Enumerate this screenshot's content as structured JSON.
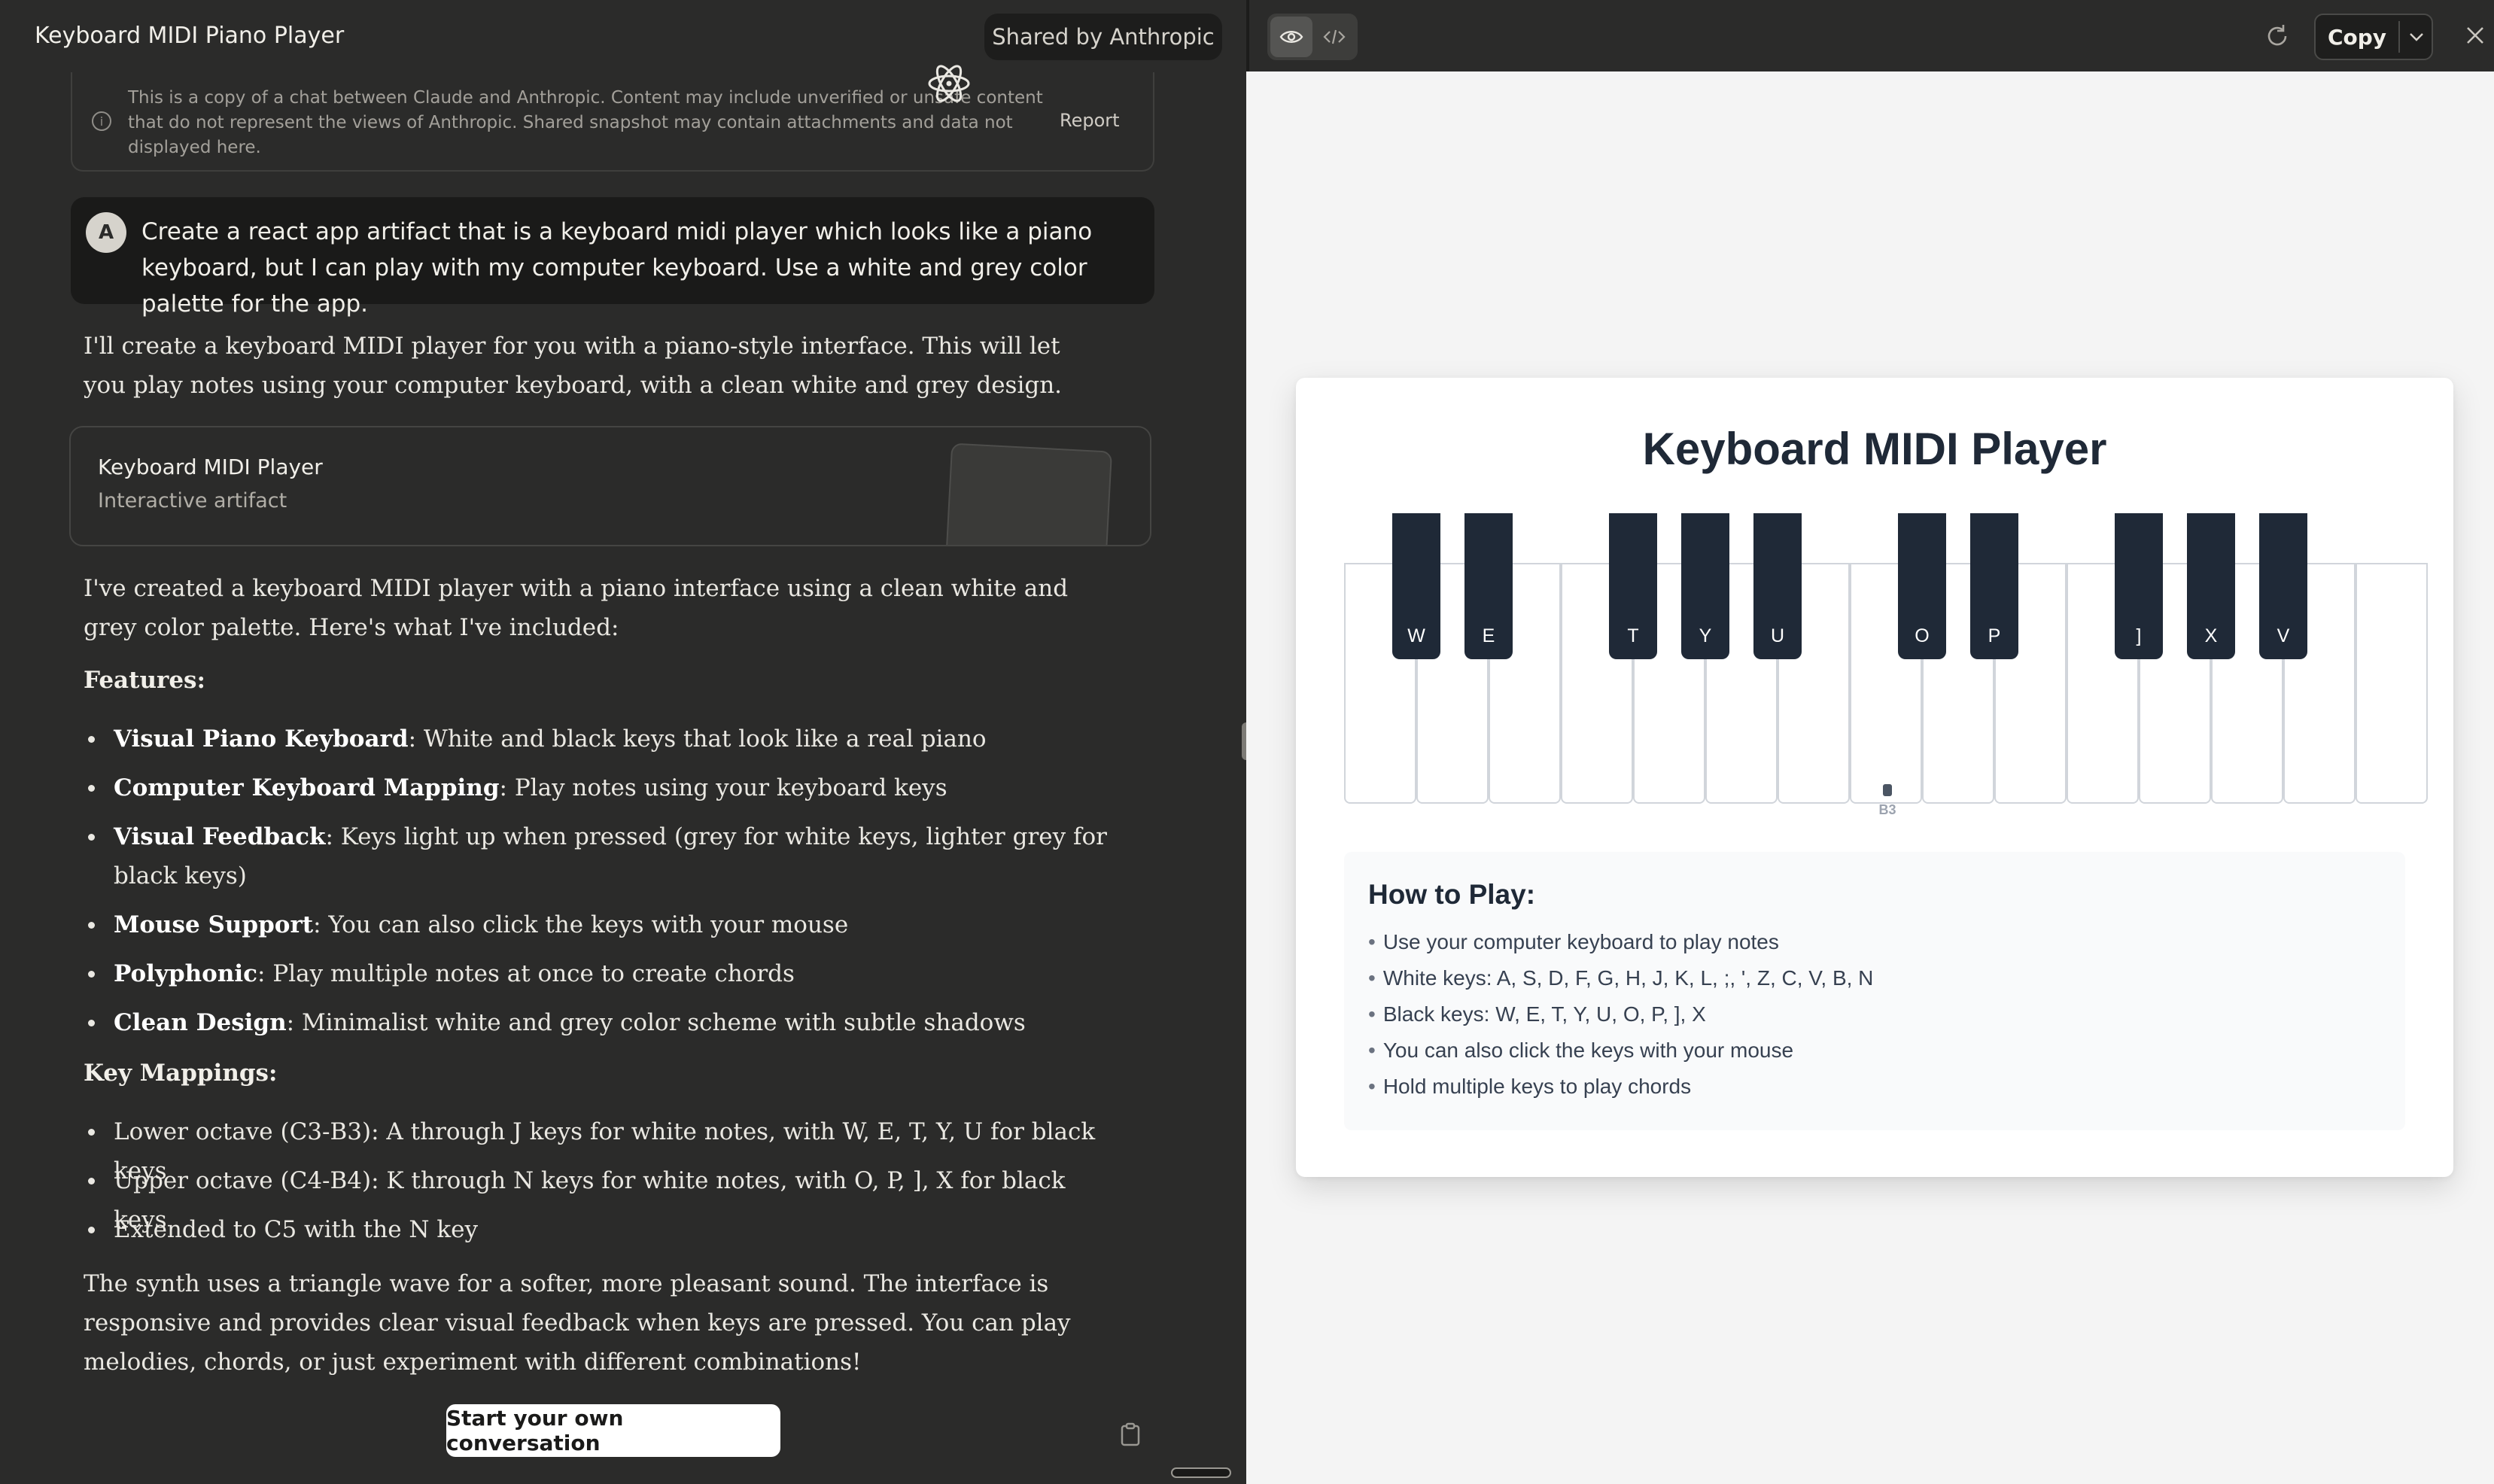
{
  "chat": {
    "title": "Keyboard MIDI Piano Player",
    "shared_badge": "Shared by Anthropic",
    "notice": {
      "text": "This is a copy of a chat between Claude and Anthropic. Content may include unverified or unsafe content that do not represent the views of Anthropic. Shared snapshot may contain attachments and data not displayed here.",
      "report_label": "Report"
    },
    "user": {
      "avatar_letter": "A",
      "message": "Create a react app artifact that is a keyboard midi player which looks like a piano keyboard, but I can play with my computer keyboard. Use a white and grey color palette for the app."
    },
    "intro": "I'll create a keyboard MIDI player for you with a piano-style interface. This will let you play notes using your computer keyboard, with a clean white and grey design.",
    "artifact": {
      "title": "Keyboard MIDI Player",
      "subtitle": "Interactive artifact",
      "icon": "react-atom-icon"
    },
    "summary": "I've created a keyboard MIDI player with a piano interface using a clean white and grey color palette. Here's what I've included:",
    "features_heading": "Features:",
    "features": [
      {
        "bold": "Visual Piano Keyboard",
        "text": ": White and black keys that look like a real piano"
      },
      {
        "bold": "Computer Keyboard Mapping",
        "text": ": Play notes using your keyboard keys"
      },
      {
        "bold": "Visual Feedback",
        "text": ": Keys light up when pressed (grey for white keys, lighter grey for black keys)"
      },
      {
        "bold": "Mouse Support",
        "text": ": You can also click the keys with your mouse"
      },
      {
        "bold": "Polyphonic",
        "text": ": Play multiple notes at once to create chords"
      },
      {
        "bold": "Clean Design",
        "text": ": Minimalist white and grey color scheme with subtle shadows"
      }
    ],
    "mappings_heading": "Key Mappings:",
    "mappings": [
      "Lower octave (C3-B3): A through J keys for white notes, with W, E, T, Y, U for black keys",
      "Upper octave (C4-B4): K through N keys for white notes, with O, P, ], X for black keys",
      "Extended to C5 with the N key"
    ],
    "closing": "The synth uses a triangle wave for a softer, more pleasant sound. The interface is responsive and provides clear visual feedback when keys are pressed. You can play melodies, chords, or just experiment with different combinations!",
    "start_button": "Start your own conversation"
  },
  "preview": {
    "copy_label": "Copy",
    "app_title": "Keyboard MIDI Player",
    "white_key_count": 15,
    "black_keys": [
      {
        "label": "W",
        "after_white": 0
      },
      {
        "label": "E",
        "after_white": 1
      },
      {
        "label": "T",
        "after_white": 3
      },
      {
        "label": "Y",
        "after_white": 4
      },
      {
        "label": "U",
        "after_white": 5
      },
      {
        "label": "O",
        "after_white": 7
      },
      {
        "label": "P",
        "after_white": 8
      },
      {
        "label": "]",
        "after_white": 10
      },
      {
        "label": "X",
        "after_white": 11
      },
      {
        "label": "V",
        "after_white": 12
      }
    ],
    "key_note_label": "B3",
    "howto": {
      "title": "How to Play:",
      "items": [
        "Use your computer keyboard to play notes",
        "White keys: A, S, D, F, G, H, J, K, L, ;, ', Z, C, V, B, N",
        "Black keys: W, E, T, Y, U, O, P, ], X",
        "You can also click the keys with your mouse",
        "Hold multiple keys to play chords"
      ]
    }
  },
  "colors": {
    "chat_bg": "#2b2b2a",
    "user_bubble": "#1a1a19",
    "preview_bg": "#f4f4f4",
    "black_key": "#1f2937",
    "white_key_border": "#d1d5db"
  }
}
